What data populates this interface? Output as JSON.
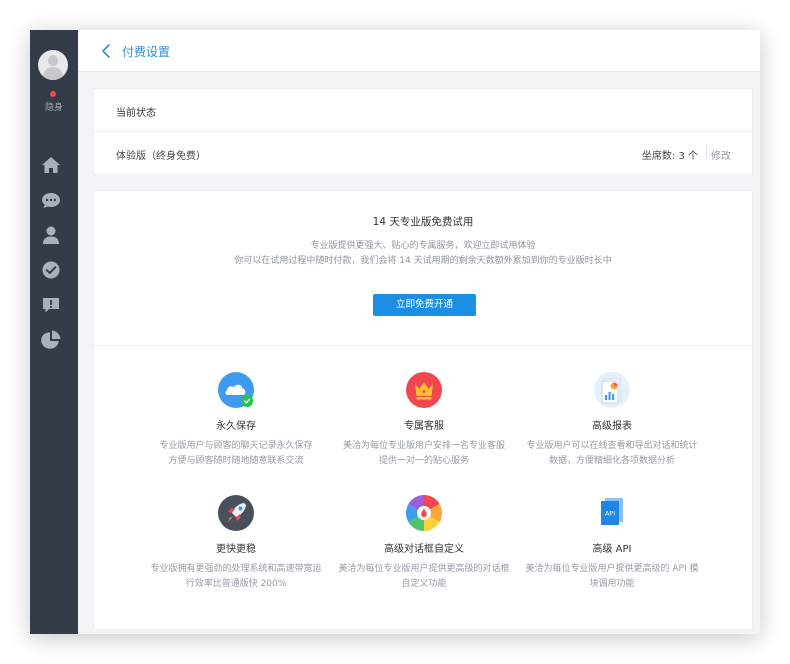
{
  "sidebar": {
    "status_label": "隐身",
    "nav": [
      {
        "icon": "home-icon"
      },
      {
        "icon": "chat-icon"
      },
      {
        "icon": "user-icon"
      },
      {
        "icon": "check-circle-icon"
      },
      {
        "icon": "message-alert-icon"
      },
      {
        "icon": "pie-chart-icon"
      }
    ]
  },
  "header": {
    "title": "付费设置"
  },
  "current_status": {
    "title": "当前状态",
    "plan": "体验版（终身免费）",
    "seats": "坐席数: 3 个",
    "modify_label": "修改"
  },
  "promo": {
    "title": "14 天专业版免费试用",
    "line1": "专业版提供更强大、贴心的专属服务，欢迎立即试用体验",
    "line2": "你可以在试用过程中随时付款，我们会将 14 天试用期的剩余天数额外累加到你的专业版时长中",
    "button_label": "立即免费开通"
  },
  "features": [
    {
      "name": "永久保存",
      "desc1": "专业版用户与顾客的聊天记录永久保存",
      "desc2": "方便与顾客随时随地随意联系交流",
      "icon": "cloud-save-icon"
    },
    {
      "name": "专属客服",
      "desc1": "美洽为每位专业版用户安排一名专业客服",
      "desc2": "提供一对一的贴心服务",
      "icon": "crown-icon"
    },
    {
      "name": "高级报表",
      "desc1": "专业版用户可以在线查看和导出对话和统计",
      "desc2": "数据，方便精细化各项数据分析",
      "icon": "report-icon"
    },
    {
      "name": "更快更稳",
      "desc1": "专业版拥有更强劲的处理系统和高速带宽运",
      "desc2": "行效率比普通版快 200%",
      "icon": "rocket-icon"
    },
    {
      "name": "高级对话框自定义",
      "desc1": "美洽为每位专业版用户提供更高级的对话框",
      "desc2": "自定义功能",
      "icon": "color-wheel-icon"
    },
    {
      "name": "高级 API",
      "desc1": "美洽为每位专业版用户提供更高级的 API 模",
      "desc2": "块调用功能",
      "icon": "api-icon",
      "icon_text": "API"
    }
  ],
  "colors": {
    "sidebar_bg": "#343d47",
    "accent": "#1a8fe3",
    "status_dot": "#f04a4a"
  }
}
